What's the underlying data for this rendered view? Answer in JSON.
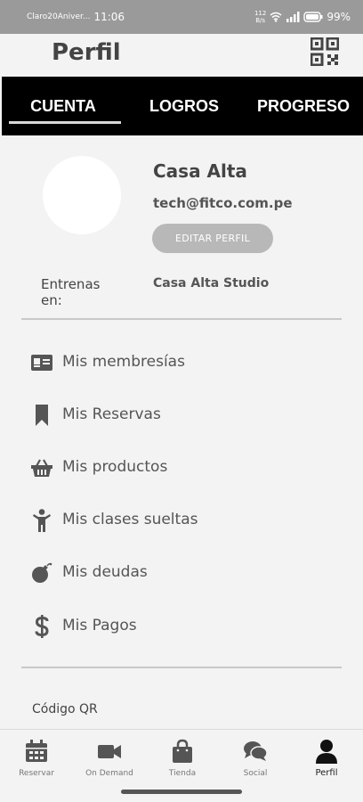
{
  "status_bar": {
    "carrier": "Claro20Aniver...",
    "time": "11:06",
    "speed_top": "112",
    "speed_bottom": "B/s",
    "battery": "99%"
  },
  "header": {
    "title": "Perfil",
    "qr_icon": "qr-code-icon"
  },
  "tabs": [
    {
      "label": "CUENTA",
      "active": true
    },
    {
      "label": "LOGROS",
      "active": false
    },
    {
      "label": "PROGRESO",
      "active": false
    }
  ],
  "profile": {
    "name": "Casa Alta",
    "email": "tech@fitco.com.pe",
    "edit_label": "EDITAR PERFIL",
    "trains_label": "Entrenas en:",
    "trains_value": "Casa Alta Studio"
  },
  "menu": [
    {
      "label": "Mis membresías",
      "icon": "id-card-icon"
    },
    {
      "label": "Mis Reservas",
      "icon": "bookmark-icon"
    },
    {
      "label": "Mis productos",
      "icon": "basket-icon"
    },
    {
      "label": "Mis clases sueltas",
      "icon": "person-icon"
    },
    {
      "label": "Mis deudas",
      "icon": "bomb-icon"
    },
    {
      "label": "Mis Pagos",
      "icon": "dollar-icon"
    }
  ],
  "qr_section": {
    "label": "Código QR"
  },
  "bottom_nav": [
    {
      "label": "Reservar",
      "icon": "calendar-icon",
      "active": false
    },
    {
      "label": "On Demand",
      "icon": "video-camera-icon",
      "active": false
    },
    {
      "label": "Tienda",
      "icon": "shopping-bag-icon",
      "active": false
    },
    {
      "label": "Social",
      "icon": "chat-bubbles-icon",
      "active": false
    },
    {
      "label": "Perfil",
      "icon": "user-icon",
      "active": true
    }
  ]
}
